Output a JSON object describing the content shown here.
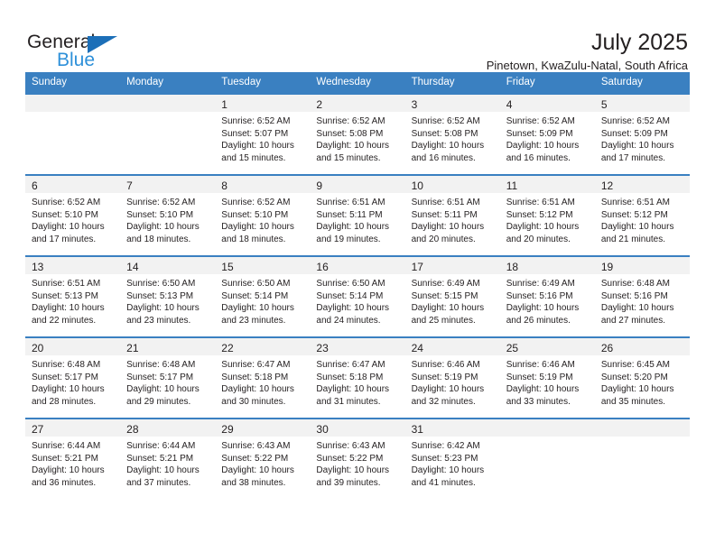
{
  "logo": {
    "word_top": "General",
    "word_bottom": "Blue",
    "triangle_color": "#1c6fb8",
    "blue_color": "#2e90d9"
  },
  "header": {
    "title": "July 2025",
    "subtitle": "Pinetown, KwaZulu-Natal, South Africa"
  },
  "theme": {
    "header_bg": "#3a80c1",
    "daynum_bg": "#f2f2f2",
    "text": "#231f20"
  },
  "calendar": {
    "weekday_headers": [
      "Sunday",
      "Monday",
      "Tuesday",
      "Wednesday",
      "Thursday",
      "Friday",
      "Saturday"
    ],
    "weeks": [
      [
        {
          "day": "",
          "sunrise": "",
          "sunset": "",
          "daylight1": "",
          "daylight2": ""
        },
        {
          "day": "",
          "sunrise": "",
          "sunset": "",
          "daylight1": "",
          "daylight2": ""
        },
        {
          "day": "1",
          "sunrise": "Sunrise: 6:52 AM",
          "sunset": "Sunset: 5:07 PM",
          "daylight1": "Daylight: 10 hours",
          "daylight2": "and 15 minutes."
        },
        {
          "day": "2",
          "sunrise": "Sunrise: 6:52 AM",
          "sunset": "Sunset: 5:08 PM",
          "daylight1": "Daylight: 10 hours",
          "daylight2": "and 15 minutes."
        },
        {
          "day": "3",
          "sunrise": "Sunrise: 6:52 AM",
          "sunset": "Sunset: 5:08 PM",
          "daylight1": "Daylight: 10 hours",
          "daylight2": "and 16 minutes."
        },
        {
          "day": "4",
          "sunrise": "Sunrise: 6:52 AM",
          "sunset": "Sunset: 5:09 PM",
          "daylight1": "Daylight: 10 hours",
          "daylight2": "and 16 minutes."
        },
        {
          "day": "5",
          "sunrise": "Sunrise: 6:52 AM",
          "sunset": "Sunset: 5:09 PM",
          "daylight1": "Daylight: 10 hours",
          "daylight2": "and 17 minutes."
        }
      ],
      [
        {
          "day": "6",
          "sunrise": "Sunrise: 6:52 AM",
          "sunset": "Sunset: 5:10 PM",
          "daylight1": "Daylight: 10 hours",
          "daylight2": "and 17 minutes."
        },
        {
          "day": "7",
          "sunrise": "Sunrise: 6:52 AM",
          "sunset": "Sunset: 5:10 PM",
          "daylight1": "Daylight: 10 hours",
          "daylight2": "and 18 minutes."
        },
        {
          "day": "8",
          "sunrise": "Sunrise: 6:52 AM",
          "sunset": "Sunset: 5:10 PM",
          "daylight1": "Daylight: 10 hours",
          "daylight2": "and 18 minutes."
        },
        {
          "day": "9",
          "sunrise": "Sunrise: 6:51 AM",
          "sunset": "Sunset: 5:11 PM",
          "daylight1": "Daylight: 10 hours",
          "daylight2": "and 19 minutes."
        },
        {
          "day": "10",
          "sunrise": "Sunrise: 6:51 AM",
          "sunset": "Sunset: 5:11 PM",
          "daylight1": "Daylight: 10 hours",
          "daylight2": "and 20 minutes."
        },
        {
          "day": "11",
          "sunrise": "Sunrise: 6:51 AM",
          "sunset": "Sunset: 5:12 PM",
          "daylight1": "Daylight: 10 hours",
          "daylight2": "and 20 minutes."
        },
        {
          "day": "12",
          "sunrise": "Sunrise: 6:51 AM",
          "sunset": "Sunset: 5:12 PM",
          "daylight1": "Daylight: 10 hours",
          "daylight2": "and 21 minutes."
        }
      ],
      [
        {
          "day": "13",
          "sunrise": "Sunrise: 6:51 AM",
          "sunset": "Sunset: 5:13 PM",
          "daylight1": "Daylight: 10 hours",
          "daylight2": "and 22 minutes."
        },
        {
          "day": "14",
          "sunrise": "Sunrise: 6:50 AM",
          "sunset": "Sunset: 5:13 PM",
          "daylight1": "Daylight: 10 hours",
          "daylight2": "and 23 minutes."
        },
        {
          "day": "15",
          "sunrise": "Sunrise: 6:50 AM",
          "sunset": "Sunset: 5:14 PM",
          "daylight1": "Daylight: 10 hours",
          "daylight2": "and 23 minutes."
        },
        {
          "day": "16",
          "sunrise": "Sunrise: 6:50 AM",
          "sunset": "Sunset: 5:14 PM",
          "daylight1": "Daylight: 10 hours",
          "daylight2": "and 24 minutes."
        },
        {
          "day": "17",
          "sunrise": "Sunrise: 6:49 AM",
          "sunset": "Sunset: 5:15 PM",
          "daylight1": "Daylight: 10 hours",
          "daylight2": "and 25 minutes."
        },
        {
          "day": "18",
          "sunrise": "Sunrise: 6:49 AM",
          "sunset": "Sunset: 5:16 PM",
          "daylight1": "Daylight: 10 hours",
          "daylight2": "and 26 minutes."
        },
        {
          "day": "19",
          "sunrise": "Sunrise: 6:48 AM",
          "sunset": "Sunset: 5:16 PM",
          "daylight1": "Daylight: 10 hours",
          "daylight2": "and 27 minutes."
        }
      ],
      [
        {
          "day": "20",
          "sunrise": "Sunrise: 6:48 AM",
          "sunset": "Sunset: 5:17 PM",
          "daylight1": "Daylight: 10 hours",
          "daylight2": "and 28 minutes."
        },
        {
          "day": "21",
          "sunrise": "Sunrise: 6:48 AM",
          "sunset": "Sunset: 5:17 PM",
          "daylight1": "Daylight: 10 hours",
          "daylight2": "and 29 minutes."
        },
        {
          "day": "22",
          "sunrise": "Sunrise: 6:47 AM",
          "sunset": "Sunset: 5:18 PM",
          "daylight1": "Daylight: 10 hours",
          "daylight2": "and 30 minutes."
        },
        {
          "day": "23",
          "sunrise": "Sunrise: 6:47 AM",
          "sunset": "Sunset: 5:18 PM",
          "daylight1": "Daylight: 10 hours",
          "daylight2": "and 31 minutes."
        },
        {
          "day": "24",
          "sunrise": "Sunrise: 6:46 AM",
          "sunset": "Sunset: 5:19 PM",
          "daylight1": "Daylight: 10 hours",
          "daylight2": "and 32 minutes."
        },
        {
          "day": "25",
          "sunrise": "Sunrise: 6:46 AM",
          "sunset": "Sunset: 5:19 PM",
          "daylight1": "Daylight: 10 hours",
          "daylight2": "and 33 minutes."
        },
        {
          "day": "26",
          "sunrise": "Sunrise: 6:45 AM",
          "sunset": "Sunset: 5:20 PM",
          "daylight1": "Daylight: 10 hours",
          "daylight2": "and 35 minutes."
        }
      ],
      [
        {
          "day": "27",
          "sunrise": "Sunrise: 6:44 AM",
          "sunset": "Sunset: 5:21 PM",
          "daylight1": "Daylight: 10 hours",
          "daylight2": "and 36 minutes."
        },
        {
          "day": "28",
          "sunrise": "Sunrise: 6:44 AM",
          "sunset": "Sunset: 5:21 PM",
          "daylight1": "Daylight: 10 hours",
          "daylight2": "and 37 minutes."
        },
        {
          "day": "29",
          "sunrise": "Sunrise: 6:43 AM",
          "sunset": "Sunset: 5:22 PM",
          "daylight1": "Daylight: 10 hours",
          "daylight2": "and 38 minutes."
        },
        {
          "day": "30",
          "sunrise": "Sunrise: 6:43 AM",
          "sunset": "Sunset: 5:22 PM",
          "daylight1": "Daylight: 10 hours",
          "daylight2": "and 39 minutes."
        },
        {
          "day": "31",
          "sunrise": "Sunrise: 6:42 AM",
          "sunset": "Sunset: 5:23 PM",
          "daylight1": "Daylight: 10 hours",
          "daylight2": "and 41 minutes."
        },
        {
          "day": "",
          "sunrise": "",
          "sunset": "",
          "daylight1": "",
          "daylight2": ""
        },
        {
          "day": "",
          "sunrise": "",
          "sunset": "",
          "daylight1": "",
          "daylight2": ""
        }
      ]
    ]
  }
}
